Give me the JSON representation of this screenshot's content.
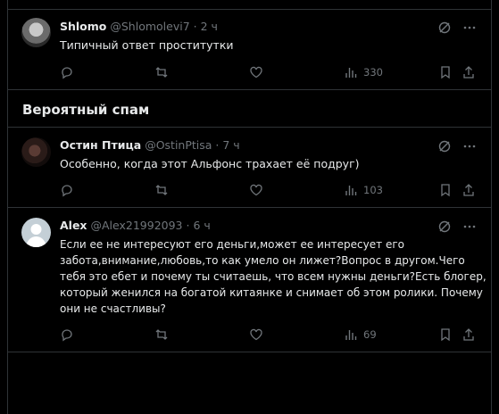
{
  "section_heading": "Вероятный спам",
  "tweets": [
    {
      "name": "Shlomo",
      "handle": "@Shlomolevi7",
      "sep": "·",
      "time": "2 ч",
      "lines": [
        "Типичный ответ проститутки"
      ],
      "views": "330",
      "avatar_kind": "photo-grey"
    },
    {
      "name": "Остин Птица",
      "handle": "@OstinPtisa",
      "sep": "·",
      "time": "7 ч",
      "lines": [
        "Особенно, когда этот Альфонс трахает её подруг)"
      ],
      "views": "103",
      "avatar_kind": "photo-dark"
    },
    {
      "name": "Alex",
      "handle": "@Alex21992093",
      "sep": "·",
      "time": "6 ч",
      "lines": [
        "Если ее не интересуют его деньги,может ее интересует его",
        "забота,внимание,любовь,то как умело он лижет?Вопрос в другом.Чего",
        "тебя это ебет и почему ты считаешь, что всем нужны деньги?Есть блогер,",
        "который женился на богатой китаянке и снимает об этом ролики. Почему",
        "они не счастливы?"
      ],
      "views": "69",
      "avatar_kind": "default"
    }
  ],
  "icons": {
    "grok": "grok-icon",
    "more": "more-icon",
    "reply": "reply-icon",
    "retweet": "retweet-icon",
    "like": "like-icon",
    "views": "views-icon",
    "bookmark": "bookmark-icon",
    "share": "share-icon"
  },
  "colors": {
    "background": "#000000",
    "text": "#e7e9ea",
    "muted": "#71767b",
    "border": "#2f3336"
  }
}
